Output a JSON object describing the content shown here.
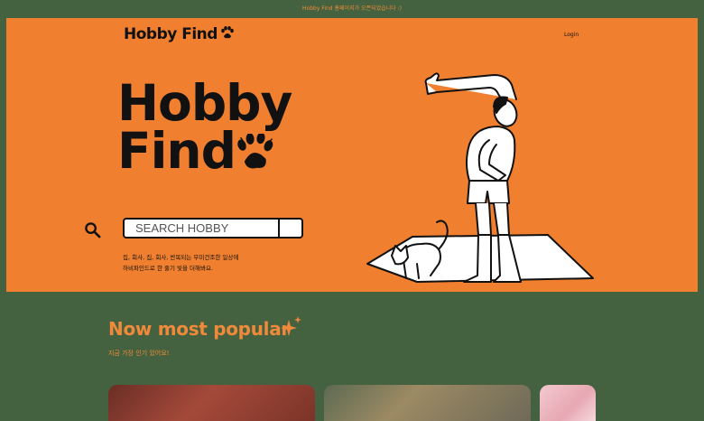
{
  "announcement": "Hobby Find 홈페이지가 오픈되었습니다 :)",
  "header": {
    "logo_text": "Hobby Find",
    "login_label": "Login"
  },
  "hero": {
    "title_line1": "Hobby",
    "title_line2": "Find",
    "search": {
      "placeholder": "SEARCH HOBBY"
    },
    "tagline_line1": "집, 회사, 집, 회사, 반복되는 무미건조한 일상에",
    "tagline_line2": "하비파인드로 한 줄기 빛을 더해봐요."
  },
  "popular": {
    "title": "Now most popular",
    "subtitle": "지금 가장 인기 있어요!"
  },
  "colors": {
    "accent_orange": "#f0802f",
    "dark_green": "#44623f",
    "ink": "#111111"
  },
  "icons": [
    "paw-icon",
    "search-icon",
    "sparkle-icon"
  ]
}
